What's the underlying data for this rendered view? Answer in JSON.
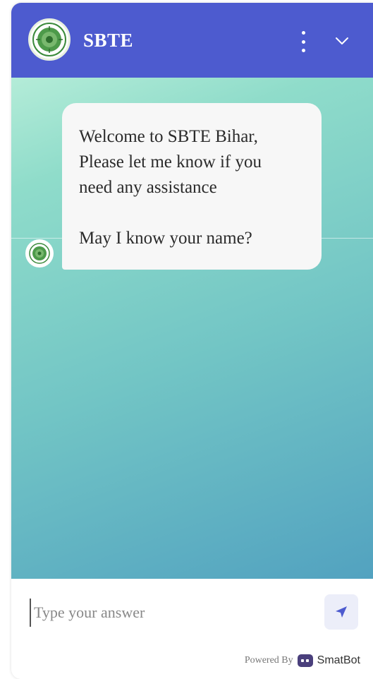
{
  "header": {
    "title": "SBTE",
    "logo_icon": "sbte-emblem-icon",
    "menu_icon": "more-vertical-icon",
    "collapse_icon": "chevron-down-icon",
    "background_color": "#4d5bcf"
  },
  "chat": {
    "messages": [
      {
        "sender": "bot",
        "lines": [
          "Welcome to SBTE Bihar,",
          "Please let me know if you",
          "need any assistance",
          "May I know your name?"
        ]
      }
    ],
    "gradient_colors": [
      "#b4ecd8",
      "#52a2c0"
    ]
  },
  "composer": {
    "placeholder": "Type your answer",
    "value": "",
    "send_icon": "send-icon"
  },
  "footer": {
    "powered_by": "Powered By",
    "brand": "SmatBot",
    "brand_icon": "smatbot-logo-icon"
  }
}
